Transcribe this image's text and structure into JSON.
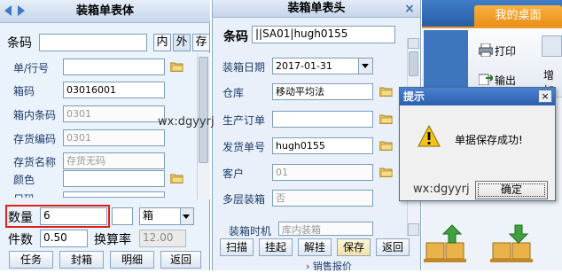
{
  "left_panel": {
    "title": "装箱单表体",
    "barcode_label": "条码",
    "toggle": [
      "内",
      "外",
      "存"
    ],
    "fields": [
      {
        "label": "单/行号",
        "value": ""
      },
      {
        "label": "箱码",
        "value": "03016001"
      },
      {
        "label": "箱内条码",
        "value": "0301"
      },
      {
        "label": "存货编码",
        "value": "0301"
      },
      {
        "label": "存货名称",
        "value": "存货无码"
      },
      {
        "label": "颜色",
        "value": ""
      },
      {
        "label": "尺码",
        "value": ""
      }
    ],
    "qty_label": "数量",
    "qty_value": "6",
    "unit_value": "箱",
    "pieces_label": "件数",
    "pieces_value": "0.50",
    "ratio_label": "换算率",
    "ratio_value": "12.00",
    "buttons": [
      "任务",
      "封箱",
      "明细",
      "返回"
    ]
  },
  "middle_panel": {
    "title": "装箱单表头",
    "close": "×",
    "barcode_label": "条码",
    "barcode_value": "||SA01|hugh0155",
    "fields": [
      {
        "label": "装箱日期",
        "value": "2017-01-31"
      },
      {
        "label": "仓库",
        "value": "移动平均法"
      },
      {
        "label": "生产订单",
        "value": ""
      },
      {
        "label": "发货单号",
        "value": "hugh0155"
      },
      {
        "label": "客户",
        "value": "01"
      },
      {
        "label": "多层装箱",
        "value": "否"
      },
      {
        "label": "装箱时机",
        "value": "库内装箱"
      }
    ],
    "buttons": [
      "扫描",
      "挂起",
      "解挂",
      "保存",
      "返回"
    ],
    "bottom_text": "销售报价"
  },
  "right_panel": {
    "tab": "我的桌面",
    "print_label": "打印",
    "export_label": "输出",
    "add_label": "增加"
  },
  "dialog": {
    "title": "提示",
    "message": "单据保存成功!",
    "ok": "确定",
    "close": "×"
  },
  "watermarks": [
    "wx:dgyyrj",
    "wx:dgyyrj"
  ],
  "colors": {
    "panel_bg": "#eaf2fb",
    "title_bg": "#c6d6ea",
    "highlight": "#e0211b",
    "accent": "#ea8f18"
  }
}
